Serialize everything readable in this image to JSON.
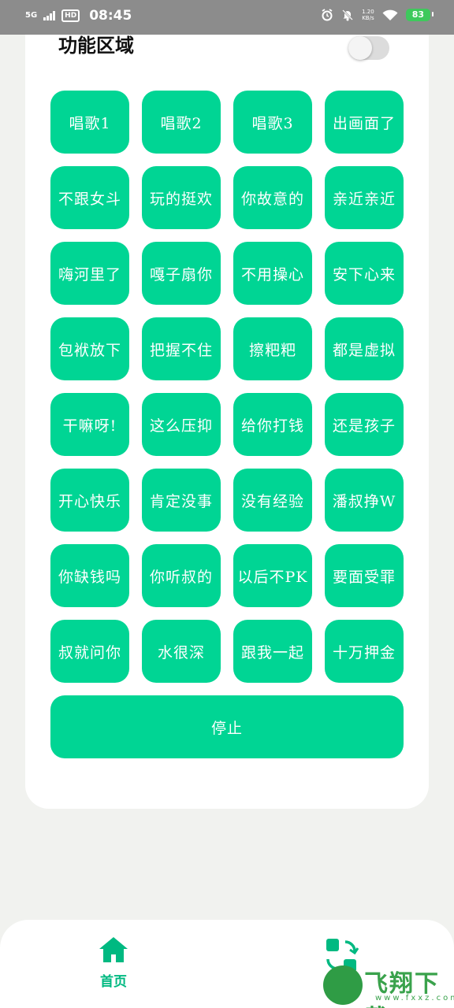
{
  "status_bar": {
    "network": "5G",
    "hd": "HD",
    "time": "08:45",
    "speed_value": "1.20",
    "speed_unit": "KB/s",
    "battery": "83"
  },
  "section": {
    "title": "功能区域",
    "toggle_on": false
  },
  "buttons": [
    "唱歌1",
    "唱歌2",
    "唱歌3",
    "出画面了",
    "不跟女斗",
    "玩的挺欢",
    "你故意的",
    "亲近亲近",
    "嗨河里了",
    "嘎子扇你",
    "不用操心",
    "安下心来",
    "包袱放下",
    "把握不住",
    "擦粑粑",
    "都是虚拟",
    "干嘛呀!",
    "这么压抑",
    "给你打钱",
    "还是孩子",
    "开心快乐",
    "肯定没事",
    "没有经验",
    "潘叔挣W",
    "你缺钱吗",
    "你听叔的",
    "以后不PK",
    "要面受罪",
    "叔就问你",
    "水很深",
    "跟我一起",
    "十万押金"
  ],
  "stop_label": "停止",
  "nav": {
    "home_label": "首页",
    "home_icon": "home-icon",
    "second_icon": "switch-icon"
  },
  "watermark": {
    "text": "飞翔下载",
    "url": "www.fxxz.com"
  },
  "colors": {
    "accent": "#00d594",
    "nav_active": "#00b981",
    "background": "#f1f2ef"
  }
}
